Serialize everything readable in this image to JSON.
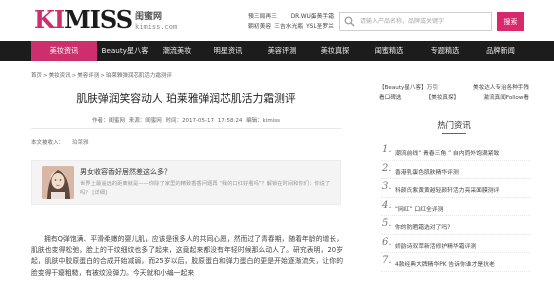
{
  "logo": {
    "brand_pink": "KI",
    "brand_black": "MISS",
    "brand_end": ".COM",
    "cn_name": "闺蜜网",
    "url": "kimiss.com"
  },
  "header": {
    "hot_links": [
      [
        "預三局再三",
        "DR.WU蛋黃手霜"
      ],
      [
        "朝初美容",
        "三吉水光瓶",
        "YSL圣罗兰"
      ]
    ],
    "search_placeholder": "请输入产品名称，品牌或关键字",
    "search_button": "搜索"
  },
  "nav": {
    "items": [
      {
        "label": "美妆资讯",
        "active": true
      },
      {
        "label": "Beauty星八客",
        "active": false
      },
      {
        "label": "潮流美妆",
        "active": false
      },
      {
        "label": "明星资讯",
        "active": false
      },
      {
        "label": "美容评测",
        "active": false
      },
      {
        "label": "美妆真探",
        "active": false
      },
      {
        "label": "闺蜜精选",
        "active": false
      },
      {
        "label": "专题精选",
        "active": false
      },
      {
        "label": "品牌新闻",
        "active": false
      }
    ]
  },
  "breadcrumb": [
    "首页",
    ">",
    "美妆资讯",
    ">",
    "美容评测",
    ">",
    "珀莱雅弹润芯肌活力霜测评"
  ],
  "article": {
    "title": "肌肤弹润笑容动人 珀莱雅弹润芯肌活力霜测评",
    "meta": "作者：闺蜜网    来源：闺蜜网    时间：2017-05-17 17:58:24    编辑：kimiss",
    "tags_label": "本文被收入：",
    "tag": "珀莱雅",
    "promo": {
      "title": "男女收容香好居然差这么多？",
      "desc": "世界上最遥远的距离就是——你除了家里的精致香香问题再 \"我的口红好看吗\"？解锁在时间和你们：你说了吗？ [详细]"
    },
    "body": "拥有Q弹饱满、平滑柔嫩的婴儿肌，应该是很多人的共同心愿，然而过了青春期，随着年龄的增长，肌肤也变得松弛，脸上的干纹细纹也多了起来，这竟起来都没有年轻时候那么动人了。研究表明，20岁起，肌肤中胶原蛋白的合成开始减弱，而25岁以后，胶原蛋白和弹力蛋白的更是开始逐渐流失，让你的脸变得干瘪粗糙，有被纹没弹力。今天就和小编一起来"
  },
  "sidebar": {
    "links": [
      [
        "【Beauty星八客】万引",
        "美妆达人专治各种手残"
      ],
      [
        "看口碑选",
        "【美妆真探】",
        "激流真闻Follow看"
      ]
    ],
    "hot_heading": "热门资讯",
    "hot_items": [
      {
        "num": "1.",
        "text": "潮流前线“ 青春三角 ” 自内而外饱满紧致"
      },
      {
        "num": "2.",
        "text": "香港乳蛋色肌肤精华评测"
      },
      {
        "num": "3.",
        "text": "科颜氏紫黄黄越轻颜轩活力亮采面膜测评"
      },
      {
        "num": "4.",
        "text": "“网红” 口红全评测"
      },
      {
        "num": "5.",
        "text": "你的防晒霜选对了吗？"
      },
      {
        "num": "6.",
        "text": "娇韵诗双萃新活修护精华霜评测"
      },
      {
        "num": "7.",
        "text": "4款经典大牌精华PK 告诉你谁才是抗老"
      }
    ]
  },
  "colors": {
    "brand_pink": "#cc2f6c",
    "nav_bg": "#1c1c1c",
    "search_button": "#d9286b"
  }
}
